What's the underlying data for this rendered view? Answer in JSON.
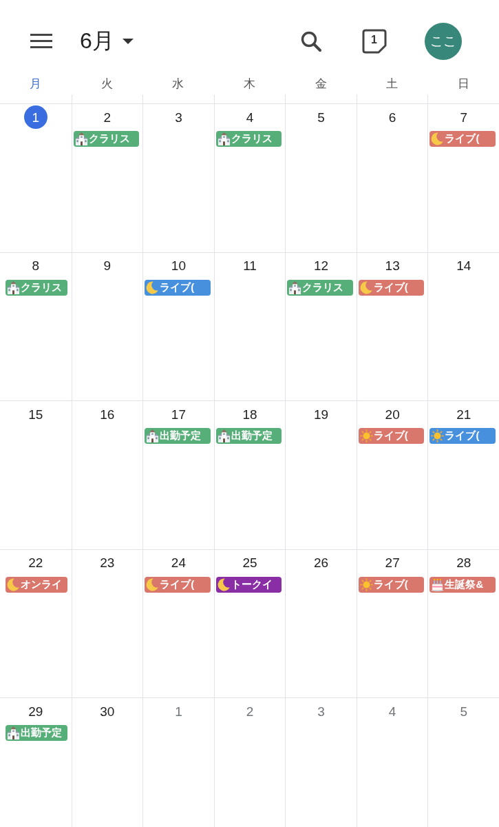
{
  "header": {
    "month": "6月",
    "today_icon": "1",
    "avatar": "ここ"
  },
  "weekdays": [
    {
      "label": "月",
      "today": true
    },
    {
      "label": "火",
      "today": false
    },
    {
      "label": "水",
      "today": false
    },
    {
      "label": "木",
      "today": false
    },
    {
      "label": "金",
      "today": false
    },
    {
      "label": "土",
      "today": false
    },
    {
      "label": "日",
      "today": false
    }
  ],
  "weeks": [
    {
      "days": [
        {
          "date": "1",
          "today": true,
          "in_month": true
        },
        {
          "date": "2",
          "today": false,
          "in_month": true,
          "events": [
            {
              "kind": "building",
              "color": "#56ae78",
              "title": "クラリス"
            }
          ]
        },
        {
          "date": "3",
          "today": false,
          "in_month": true
        },
        {
          "date": "4",
          "today": false,
          "in_month": true,
          "events": [
            {
              "kind": "building",
              "color": "#56ae78",
              "title": "クラリス"
            }
          ]
        },
        {
          "date": "5",
          "today": false,
          "in_month": true
        },
        {
          "date": "6",
          "today": false,
          "in_month": true
        },
        {
          "date": "7",
          "today": false,
          "in_month": true,
          "events": [
            {
              "kind": "moon",
              "color": "#da776c",
              "title": "ライブ("
            }
          ]
        }
      ]
    },
    {
      "days": [
        {
          "date": "8",
          "today": false,
          "in_month": true,
          "events": [
            {
              "kind": "building",
              "color": "#56ae78",
              "title": "クラリス"
            }
          ]
        },
        {
          "date": "9",
          "today": false,
          "in_month": true
        },
        {
          "date": "10",
          "today": false,
          "in_month": true,
          "events": [
            {
              "kind": "moon",
              "color": "#4690de",
              "title": "ライブ("
            }
          ]
        },
        {
          "date": "11",
          "today": false,
          "in_month": true
        },
        {
          "date": "12",
          "today": false,
          "in_month": true,
          "events": [
            {
              "kind": "building",
              "color": "#56ae78",
              "title": "クラリス"
            }
          ]
        },
        {
          "date": "13",
          "today": false,
          "in_month": true,
          "events": [
            {
              "kind": "moon",
              "color": "#da776c",
              "title": "ライブ("
            }
          ]
        },
        {
          "date": "14",
          "today": false,
          "in_month": true
        }
      ]
    },
    {
      "days": [
        {
          "date": "15",
          "today": false,
          "in_month": true
        },
        {
          "date": "16",
          "today": false,
          "in_month": true
        },
        {
          "date": "17",
          "today": false,
          "in_month": true,
          "events": [
            {
              "kind": "building",
              "color": "#56ae78",
              "title": "出勤予定"
            }
          ]
        },
        {
          "date": "18",
          "today": false,
          "in_month": true,
          "events": [
            {
              "kind": "building",
              "color": "#56ae78",
              "title": "出勤予定"
            }
          ]
        },
        {
          "date": "19",
          "today": false,
          "in_month": true
        },
        {
          "date": "20",
          "today": false,
          "in_month": true,
          "events": [
            {
              "kind": "sun",
              "color": "#da776c",
              "title": "ライブ("
            }
          ]
        },
        {
          "date": "21",
          "today": false,
          "in_month": true,
          "events": [
            {
              "kind": "sun",
              "color": "#4690de",
              "title": "ライブ("
            }
          ]
        }
      ]
    },
    {
      "days": [
        {
          "date": "22",
          "today": false,
          "in_month": true,
          "events": [
            {
              "kind": "moon",
              "color": "#da776c",
              "title": "オンライ"
            }
          ]
        },
        {
          "date": "23",
          "today": false,
          "in_month": true
        },
        {
          "date": "24",
          "today": false,
          "in_month": true,
          "events": [
            {
              "kind": "moon",
              "color": "#da776c",
              "title": "ライブ("
            }
          ]
        },
        {
          "date": "25",
          "today": false,
          "in_month": true,
          "events": [
            {
              "kind": "moon",
              "color": "#8a2ea6",
              "title": "トークイ"
            }
          ]
        },
        {
          "date": "26",
          "today": false,
          "in_month": true
        },
        {
          "date": "27",
          "today": false,
          "in_month": true,
          "events": [
            {
              "kind": "sun",
              "color": "#da776c",
              "title": "ライブ("
            }
          ]
        },
        {
          "date": "28",
          "today": false,
          "in_month": true,
          "events": [
            {
              "kind": "cake",
              "color": "#da776c",
              "title": "生誕祭&"
            }
          ]
        }
      ]
    },
    {
      "days": [
        {
          "date": "29",
          "today": false,
          "in_month": true,
          "events": [
            {
              "kind": "building",
              "color": "#56ae78",
              "title": "出勤予定"
            }
          ]
        },
        {
          "date": "30",
          "today": false,
          "in_month": true
        },
        {
          "date": "1",
          "today": false,
          "in_month": false
        },
        {
          "date": "2",
          "today": false,
          "in_month": false
        },
        {
          "date": "3",
          "today": false,
          "in_month": false
        },
        {
          "date": "4",
          "today": false,
          "in_month": false
        },
        {
          "date": "5",
          "today": false,
          "in_month": false
        }
      ]
    }
  ]
}
